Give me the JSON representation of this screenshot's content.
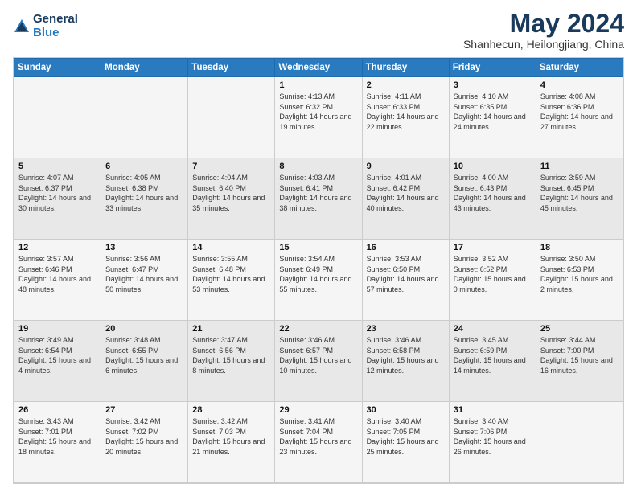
{
  "logo": {
    "general": "General",
    "blue": "Blue"
  },
  "title": "May 2024",
  "location": "Shanhecun, Heilongjiang, China",
  "days_header": [
    "Sunday",
    "Monday",
    "Tuesday",
    "Wednesday",
    "Thursday",
    "Friday",
    "Saturday"
  ],
  "weeks": [
    [
      {
        "day": "",
        "info": ""
      },
      {
        "day": "",
        "info": ""
      },
      {
        "day": "",
        "info": ""
      },
      {
        "day": "1",
        "info": "Sunrise: 4:13 AM\nSunset: 6:32 PM\nDaylight: 14 hours\nand 19 minutes."
      },
      {
        "day": "2",
        "info": "Sunrise: 4:11 AM\nSunset: 6:33 PM\nDaylight: 14 hours\nand 22 minutes."
      },
      {
        "day": "3",
        "info": "Sunrise: 4:10 AM\nSunset: 6:35 PM\nDaylight: 14 hours\nand 24 minutes."
      },
      {
        "day": "4",
        "info": "Sunrise: 4:08 AM\nSunset: 6:36 PM\nDaylight: 14 hours\nand 27 minutes."
      }
    ],
    [
      {
        "day": "5",
        "info": "Sunrise: 4:07 AM\nSunset: 6:37 PM\nDaylight: 14 hours\nand 30 minutes."
      },
      {
        "day": "6",
        "info": "Sunrise: 4:05 AM\nSunset: 6:38 PM\nDaylight: 14 hours\nand 33 minutes."
      },
      {
        "day": "7",
        "info": "Sunrise: 4:04 AM\nSunset: 6:40 PM\nDaylight: 14 hours\nand 35 minutes."
      },
      {
        "day": "8",
        "info": "Sunrise: 4:03 AM\nSunset: 6:41 PM\nDaylight: 14 hours\nand 38 minutes."
      },
      {
        "day": "9",
        "info": "Sunrise: 4:01 AM\nSunset: 6:42 PM\nDaylight: 14 hours\nand 40 minutes."
      },
      {
        "day": "10",
        "info": "Sunrise: 4:00 AM\nSunset: 6:43 PM\nDaylight: 14 hours\nand 43 minutes."
      },
      {
        "day": "11",
        "info": "Sunrise: 3:59 AM\nSunset: 6:45 PM\nDaylight: 14 hours\nand 45 minutes."
      }
    ],
    [
      {
        "day": "12",
        "info": "Sunrise: 3:57 AM\nSunset: 6:46 PM\nDaylight: 14 hours\nand 48 minutes."
      },
      {
        "day": "13",
        "info": "Sunrise: 3:56 AM\nSunset: 6:47 PM\nDaylight: 14 hours\nand 50 minutes."
      },
      {
        "day": "14",
        "info": "Sunrise: 3:55 AM\nSunset: 6:48 PM\nDaylight: 14 hours\nand 53 minutes."
      },
      {
        "day": "15",
        "info": "Sunrise: 3:54 AM\nSunset: 6:49 PM\nDaylight: 14 hours\nand 55 minutes."
      },
      {
        "day": "16",
        "info": "Sunrise: 3:53 AM\nSunset: 6:50 PM\nDaylight: 14 hours\nand 57 minutes."
      },
      {
        "day": "17",
        "info": "Sunrise: 3:52 AM\nSunset: 6:52 PM\nDaylight: 15 hours\nand 0 minutes."
      },
      {
        "day": "18",
        "info": "Sunrise: 3:50 AM\nSunset: 6:53 PM\nDaylight: 15 hours\nand 2 minutes."
      }
    ],
    [
      {
        "day": "19",
        "info": "Sunrise: 3:49 AM\nSunset: 6:54 PM\nDaylight: 15 hours\nand 4 minutes."
      },
      {
        "day": "20",
        "info": "Sunrise: 3:48 AM\nSunset: 6:55 PM\nDaylight: 15 hours\nand 6 minutes."
      },
      {
        "day": "21",
        "info": "Sunrise: 3:47 AM\nSunset: 6:56 PM\nDaylight: 15 hours\nand 8 minutes."
      },
      {
        "day": "22",
        "info": "Sunrise: 3:46 AM\nSunset: 6:57 PM\nDaylight: 15 hours\nand 10 minutes."
      },
      {
        "day": "23",
        "info": "Sunrise: 3:46 AM\nSunset: 6:58 PM\nDaylight: 15 hours\nand 12 minutes."
      },
      {
        "day": "24",
        "info": "Sunrise: 3:45 AM\nSunset: 6:59 PM\nDaylight: 15 hours\nand 14 minutes."
      },
      {
        "day": "25",
        "info": "Sunrise: 3:44 AM\nSunset: 7:00 PM\nDaylight: 15 hours\nand 16 minutes."
      }
    ],
    [
      {
        "day": "26",
        "info": "Sunrise: 3:43 AM\nSunset: 7:01 PM\nDaylight: 15 hours\nand 18 minutes."
      },
      {
        "day": "27",
        "info": "Sunrise: 3:42 AM\nSunset: 7:02 PM\nDaylight: 15 hours\nand 20 minutes."
      },
      {
        "day": "28",
        "info": "Sunrise: 3:42 AM\nSunset: 7:03 PM\nDaylight: 15 hours\nand 21 minutes."
      },
      {
        "day": "29",
        "info": "Sunrise: 3:41 AM\nSunset: 7:04 PM\nDaylight: 15 hours\nand 23 minutes."
      },
      {
        "day": "30",
        "info": "Sunrise: 3:40 AM\nSunset: 7:05 PM\nDaylight: 15 hours\nand 25 minutes."
      },
      {
        "day": "31",
        "info": "Sunrise: 3:40 AM\nSunset: 7:06 PM\nDaylight: 15 hours\nand 26 minutes."
      },
      {
        "day": "",
        "info": ""
      }
    ]
  ]
}
